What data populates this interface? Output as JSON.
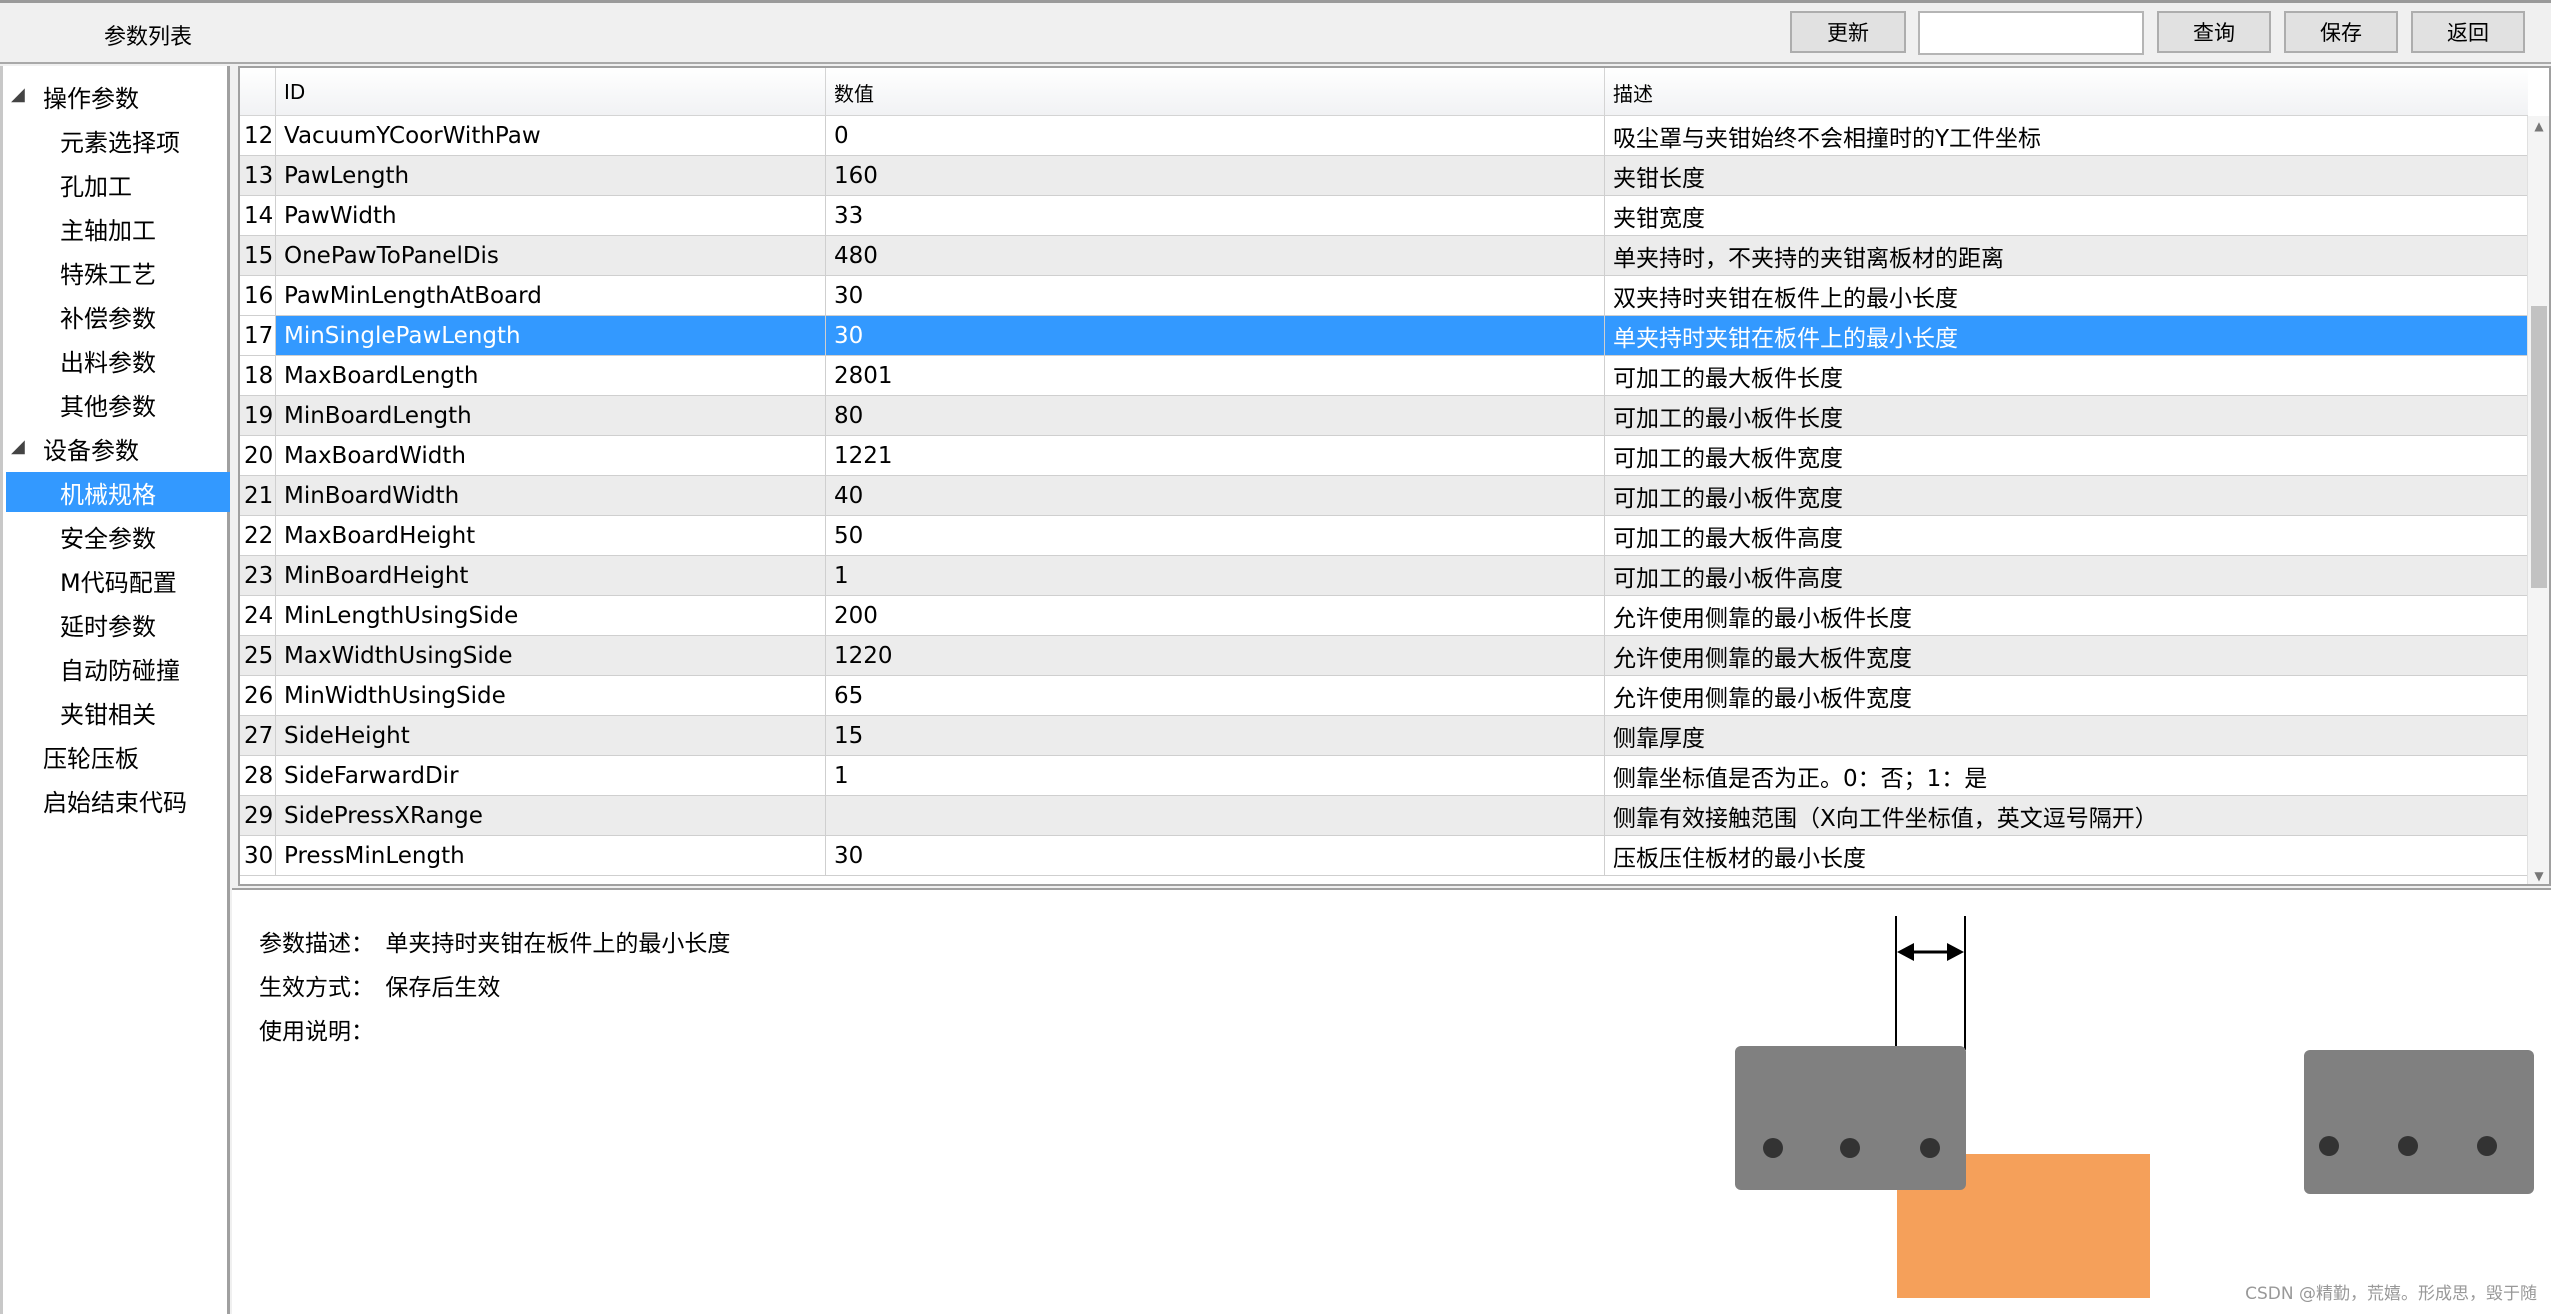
{
  "window": {
    "title": "参数列表"
  },
  "toolbar": {
    "update_label": "更新",
    "search_value": "",
    "query_label": "查询",
    "save_label": "保存",
    "back_label": "返回"
  },
  "sidebar": {
    "items": [
      {
        "label": "操作参数",
        "level": 0,
        "expanded": true
      },
      {
        "label": "元素选择项",
        "level": 1
      },
      {
        "label": "孔加工",
        "level": 1
      },
      {
        "label": "主轴加工",
        "level": 1
      },
      {
        "label": "特殊工艺",
        "level": 1
      },
      {
        "label": "补偿参数",
        "level": 1
      },
      {
        "label": "出料参数",
        "level": 1
      },
      {
        "label": "其他参数",
        "level": 1
      },
      {
        "label": "设备参数",
        "level": 0,
        "expanded": true
      },
      {
        "label": "机械规格",
        "level": 1,
        "selected": true
      },
      {
        "label": "安全参数",
        "level": 1
      },
      {
        "label": "M代码配置",
        "level": 1
      },
      {
        "label": "延时参数",
        "level": 1
      },
      {
        "label": "自动防碰撞",
        "level": 1
      },
      {
        "label": "夹钳相关",
        "level": 1
      },
      {
        "label": "压轮压板",
        "level": 0
      },
      {
        "label": "启始结束代码",
        "level": 0
      }
    ]
  },
  "table": {
    "columns": [
      "ID",
      "数值",
      "描述"
    ],
    "selected_row": 17,
    "rows": [
      {
        "no": "12",
        "id": "VacuumYCoorWithPaw",
        "value": "0",
        "desc": "吸尘罩与夹钳始终不会相撞时的Y工件坐标"
      },
      {
        "no": "13",
        "id": "PawLength",
        "value": "160",
        "desc": "夹钳长度"
      },
      {
        "no": "14",
        "id": "PawWidth",
        "value": "33",
        "desc": "夹钳宽度"
      },
      {
        "no": "15",
        "id": "OnePawToPanelDis",
        "value": "480",
        "desc": "单夹持时，不夹持的夹钳离板材的距离"
      },
      {
        "no": "16",
        "id": "PawMinLengthAtBoard",
        "value": "30",
        "desc": "双夹持时夹钳在板件上的最小长度"
      },
      {
        "no": "17",
        "id": "MinSinglePawLength",
        "value": "30",
        "desc": "单夹持时夹钳在板件上的最小长度"
      },
      {
        "no": "18",
        "id": "MaxBoardLength",
        "value": "2801",
        "desc": "可加工的最大板件长度"
      },
      {
        "no": "19",
        "id": "MinBoardLength",
        "value": "80",
        "desc": "可加工的最小板件长度"
      },
      {
        "no": "20",
        "id": "MaxBoardWidth",
        "value": "1221",
        "desc": "可加工的最大板件宽度"
      },
      {
        "no": "21",
        "id": "MinBoardWidth",
        "value": "40",
        "desc": "可加工的最小板件宽度"
      },
      {
        "no": "22",
        "id": "MaxBoardHeight",
        "value": "50",
        "desc": "可加工的最大板件高度"
      },
      {
        "no": "23",
        "id": "MinBoardHeight",
        "value": "1",
        "desc": "可加工的最小板件高度"
      },
      {
        "no": "24",
        "id": "MinLengthUsingSide",
        "value": "200",
        "desc": "允许使用侧靠的最小板件长度"
      },
      {
        "no": "25",
        "id": "MaxWidthUsingSide",
        "value": "1220",
        "desc": "允许使用侧靠的最大板件宽度"
      },
      {
        "no": "26",
        "id": "MinWidthUsingSide",
        "value": "65",
        "desc": "允许使用侧靠的最小板件宽度"
      },
      {
        "no": "27",
        "id": "SideHeight",
        "value": "15",
        "desc": "侧靠厚度"
      },
      {
        "no": "28",
        "id": "SideFarwardDir",
        "value": "1",
        "desc": "侧靠坐标值是否为正。0：否；1：是"
      },
      {
        "no": "29",
        "id": "SidePressXRange",
        "value": "",
        "desc": "侧靠有效接触范围（X向工件坐标值，英文逗号隔开）"
      },
      {
        "no": "30",
        "id": "PressMinLength",
        "value": "30",
        "desc": "压板压住板材的最小长度"
      }
    ]
  },
  "detail": {
    "desc_label": "参数描述：",
    "desc_value": "单夹持时夹钳在板件上的最小长度",
    "effect_label": "生效方式：",
    "effect_value": "保存后生效",
    "usage_label": "使用说明：",
    "usage_value": ""
  },
  "diagram": {
    "clamp_color": "#808080",
    "board_color": "#f5a05a",
    "hole_color": "#333333"
  },
  "watermark": "CSDN @精勤，荒嬉。形成思，毁于随",
  "colors": {
    "selection": "#3399ff"
  }
}
